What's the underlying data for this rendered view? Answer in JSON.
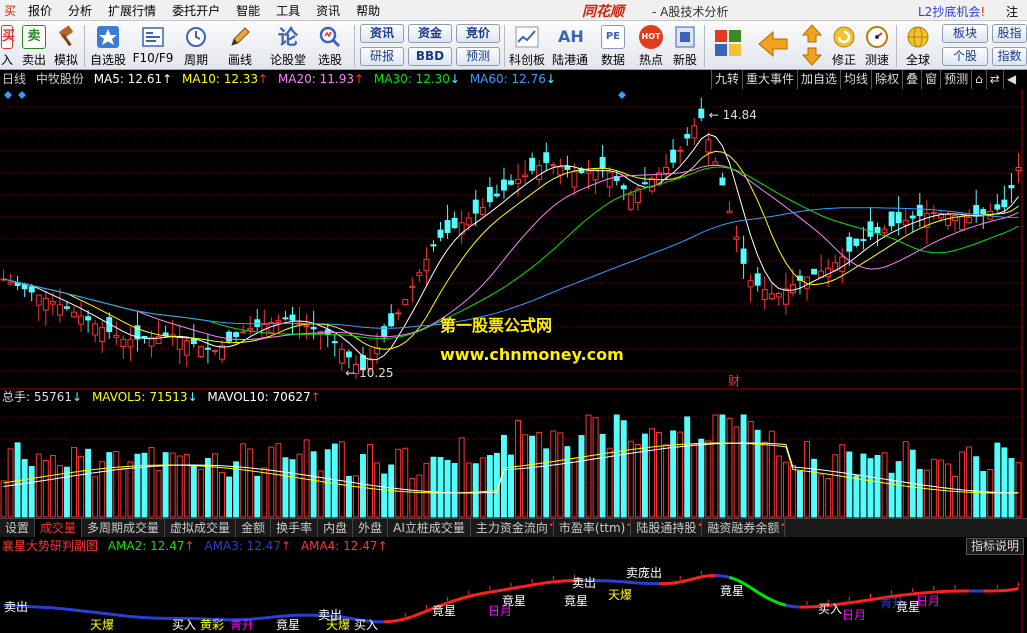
{
  "menu": {
    "items": [
      "买",
      "报价",
      "分析",
      "扩展行情",
      "委托开户",
      "智能",
      "工具",
      "资讯",
      "帮助"
    ],
    "brand": "同花顺",
    "app_title": "- A股技术分析",
    "promo_text": "L2抄底机会",
    "promo_mark": "!",
    "register": "注册"
  },
  "toolbar": {
    "buttons": [
      {
        "label": "入",
        "icon": "buy-icon"
      },
      {
        "label": "卖出",
        "icon": "sell-icon"
      },
      {
        "label": "模拟",
        "icon": "gavel-icon"
      },
      {
        "label": "自选股",
        "icon": "star-icon"
      },
      {
        "label": "F10/F9",
        "icon": "f10-icon"
      },
      {
        "label": "周期",
        "icon": "clock-icon"
      },
      {
        "label": "画线",
        "icon": "pencil-icon"
      },
      {
        "label": "论股堂",
        "icon": "lun-icon"
      },
      {
        "label": "选股",
        "icon": "search-icon"
      },
      {
        "label": "科创板",
        "icon": "line-chart-icon"
      },
      {
        "label": "陆港通",
        "icon": "ah-icon"
      },
      {
        "label": "数据",
        "icon": "pe-icon"
      },
      {
        "label": "热点",
        "icon": "hot-icon"
      },
      {
        "label": "新股",
        "icon": "new-stock-icon"
      },
      {
        "label": "修正",
        "icon": "refresh-icon"
      },
      {
        "label": "测速",
        "icon": "speed-icon"
      },
      {
        "label": "全球",
        "icon": "globe-icon"
      }
    ],
    "pills": [
      "资讯",
      "资金",
      "竞价",
      "研报",
      "BBD",
      "预测"
    ],
    "right_pills": [
      "板块",
      "股指",
      "个股",
      "指数"
    ],
    "char_icon": "AH",
    "pe_icon": "PE",
    "hot_icon": "HOT"
  },
  "chart_header": {
    "period": "日线",
    "stock": "中牧股份",
    "ma5": "MA5: 12.61",
    "ma10": "MA10: 12.33",
    "ma20": "MA20: 11.93",
    "ma30": "MA30: 12.30",
    "ma60": "MA60: 12.76",
    "arrow_up": "↑",
    "arrow_down": "↓"
  },
  "right_tabs": [
    "九转",
    "重大事件",
    "加自选",
    "均线",
    "除权",
    "叠",
    "窗",
    "预测",
    "⌂",
    "⇄",
    "◀"
  ],
  "price_labels": {
    "high": "14.84",
    "low": "10.25",
    "event": "财"
  },
  "watermark": {
    "line1": "第一股票公式网",
    "line2": "www.chnmoney.com"
  },
  "volume_header": {
    "total": "总手: 55761",
    "mavol5": "MAVOL5: 71513",
    "mavol10": "MAVOL10: 70627"
  },
  "indicator_tabs": [
    {
      "label": "设置",
      "active": false,
      "dot": false
    },
    {
      "label": "成交量",
      "active": true,
      "dot": false
    },
    {
      "label": "多周期成交量",
      "active": false,
      "dot": false
    },
    {
      "label": "虚拟成交量",
      "active": false,
      "dot": false
    },
    {
      "label": "金额",
      "active": false,
      "dot": false
    },
    {
      "label": "换手率",
      "active": false,
      "dot": false
    },
    {
      "label": "内盘",
      "active": false,
      "dot": false
    },
    {
      "label": "外盘",
      "active": false,
      "dot": false
    },
    {
      "label": "AI立桩成交量",
      "active": false,
      "dot": false
    },
    {
      "label": "主力资金流向",
      "active": false,
      "dot": true
    },
    {
      "label": "市盈率(ttm)",
      "active": false,
      "dot": true
    },
    {
      "label": "陆股通持股",
      "active": false,
      "dot": true
    },
    {
      "label": "融资融券余额",
      "active": false,
      "dot": true
    }
  ],
  "indicator_header": {
    "name": "襄星大势研判副图",
    "ama2": "AMA2: 12.47",
    "ama3": "AMA3: 12.47",
    "ama4": "AMA4: 12.47"
  },
  "indicator_help": "指标说明",
  "signals": {
    "sell": "卖出",
    "buy": "买入",
    "tianbao": "天爆",
    "jingxing": "竟星",
    "riyue": "日月",
    "qingsheng": "青升",
    "huangcai": "黄彩",
    "maiqiu": "卖庞出"
  },
  "colors": {
    "up": "#ff3232",
    "down": "#54fcfc",
    "ma5": "#ffffff",
    "ma10": "#ffff00",
    "ma20": "#ff80ff",
    "ma30": "#00e600",
    "ma60": "#2fa0ff",
    "grid": "#7a0000",
    "text_label": "#ff3232"
  }
}
